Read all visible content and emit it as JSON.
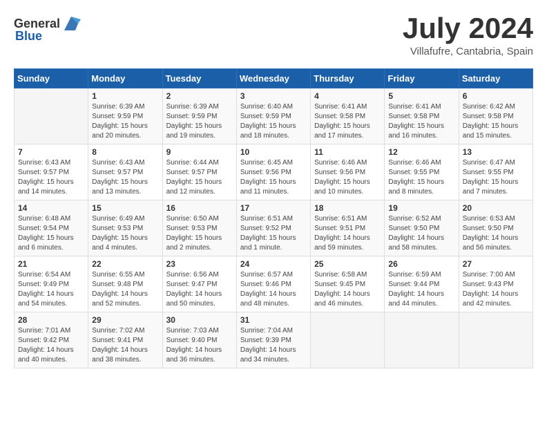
{
  "header": {
    "logo_general": "General",
    "logo_blue": "Blue",
    "month_title": "July 2024",
    "subtitle": "Villafufre, Cantabria, Spain"
  },
  "weekdays": [
    "Sunday",
    "Monday",
    "Tuesday",
    "Wednesday",
    "Thursday",
    "Friday",
    "Saturday"
  ],
  "weeks": [
    [
      {
        "day": "",
        "info": ""
      },
      {
        "day": "1",
        "info": "Sunrise: 6:39 AM\nSunset: 9:59 PM\nDaylight: 15 hours\nand 20 minutes."
      },
      {
        "day": "2",
        "info": "Sunrise: 6:39 AM\nSunset: 9:59 PM\nDaylight: 15 hours\nand 19 minutes."
      },
      {
        "day": "3",
        "info": "Sunrise: 6:40 AM\nSunset: 9:59 PM\nDaylight: 15 hours\nand 18 minutes."
      },
      {
        "day": "4",
        "info": "Sunrise: 6:41 AM\nSunset: 9:58 PM\nDaylight: 15 hours\nand 17 minutes."
      },
      {
        "day": "5",
        "info": "Sunrise: 6:41 AM\nSunset: 9:58 PM\nDaylight: 15 hours\nand 16 minutes."
      },
      {
        "day": "6",
        "info": "Sunrise: 6:42 AM\nSunset: 9:58 PM\nDaylight: 15 hours\nand 15 minutes."
      }
    ],
    [
      {
        "day": "7",
        "info": "Sunrise: 6:43 AM\nSunset: 9:57 PM\nDaylight: 15 hours\nand 14 minutes."
      },
      {
        "day": "8",
        "info": "Sunrise: 6:43 AM\nSunset: 9:57 PM\nDaylight: 15 hours\nand 13 minutes."
      },
      {
        "day": "9",
        "info": "Sunrise: 6:44 AM\nSunset: 9:57 PM\nDaylight: 15 hours\nand 12 minutes."
      },
      {
        "day": "10",
        "info": "Sunrise: 6:45 AM\nSunset: 9:56 PM\nDaylight: 15 hours\nand 11 minutes."
      },
      {
        "day": "11",
        "info": "Sunrise: 6:46 AM\nSunset: 9:56 PM\nDaylight: 15 hours\nand 10 minutes."
      },
      {
        "day": "12",
        "info": "Sunrise: 6:46 AM\nSunset: 9:55 PM\nDaylight: 15 hours\nand 8 minutes."
      },
      {
        "day": "13",
        "info": "Sunrise: 6:47 AM\nSunset: 9:55 PM\nDaylight: 15 hours\nand 7 minutes."
      }
    ],
    [
      {
        "day": "14",
        "info": "Sunrise: 6:48 AM\nSunset: 9:54 PM\nDaylight: 15 hours\nand 6 minutes."
      },
      {
        "day": "15",
        "info": "Sunrise: 6:49 AM\nSunset: 9:53 PM\nDaylight: 15 hours\nand 4 minutes."
      },
      {
        "day": "16",
        "info": "Sunrise: 6:50 AM\nSunset: 9:53 PM\nDaylight: 15 hours\nand 2 minutes."
      },
      {
        "day": "17",
        "info": "Sunrise: 6:51 AM\nSunset: 9:52 PM\nDaylight: 15 hours\nand 1 minute."
      },
      {
        "day": "18",
        "info": "Sunrise: 6:51 AM\nSunset: 9:51 PM\nDaylight: 14 hours\nand 59 minutes."
      },
      {
        "day": "19",
        "info": "Sunrise: 6:52 AM\nSunset: 9:50 PM\nDaylight: 14 hours\nand 58 minutes."
      },
      {
        "day": "20",
        "info": "Sunrise: 6:53 AM\nSunset: 9:50 PM\nDaylight: 14 hours\nand 56 minutes."
      }
    ],
    [
      {
        "day": "21",
        "info": "Sunrise: 6:54 AM\nSunset: 9:49 PM\nDaylight: 14 hours\nand 54 minutes."
      },
      {
        "day": "22",
        "info": "Sunrise: 6:55 AM\nSunset: 9:48 PM\nDaylight: 14 hours\nand 52 minutes."
      },
      {
        "day": "23",
        "info": "Sunrise: 6:56 AM\nSunset: 9:47 PM\nDaylight: 14 hours\nand 50 minutes."
      },
      {
        "day": "24",
        "info": "Sunrise: 6:57 AM\nSunset: 9:46 PM\nDaylight: 14 hours\nand 48 minutes."
      },
      {
        "day": "25",
        "info": "Sunrise: 6:58 AM\nSunset: 9:45 PM\nDaylight: 14 hours\nand 46 minutes."
      },
      {
        "day": "26",
        "info": "Sunrise: 6:59 AM\nSunset: 9:44 PM\nDaylight: 14 hours\nand 44 minutes."
      },
      {
        "day": "27",
        "info": "Sunrise: 7:00 AM\nSunset: 9:43 PM\nDaylight: 14 hours\nand 42 minutes."
      }
    ],
    [
      {
        "day": "28",
        "info": "Sunrise: 7:01 AM\nSunset: 9:42 PM\nDaylight: 14 hours\nand 40 minutes."
      },
      {
        "day": "29",
        "info": "Sunrise: 7:02 AM\nSunset: 9:41 PM\nDaylight: 14 hours\nand 38 minutes."
      },
      {
        "day": "30",
        "info": "Sunrise: 7:03 AM\nSunset: 9:40 PM\nDaylight: 14 hours\nand 36 minutes."
      },
      {
        "day": "31",
        "info": "Sunrise: 7:04 AM\nSunset: 9:39 PM\nDaylight: 14 hours\nand 34 minutes."
      },
      {
        "day": "",
        "info": ""
      },
      {
        "day": "",
        "info": ""
      },
      {
        "day": "",
        "info": ""
      }
    ]
  ]
}
